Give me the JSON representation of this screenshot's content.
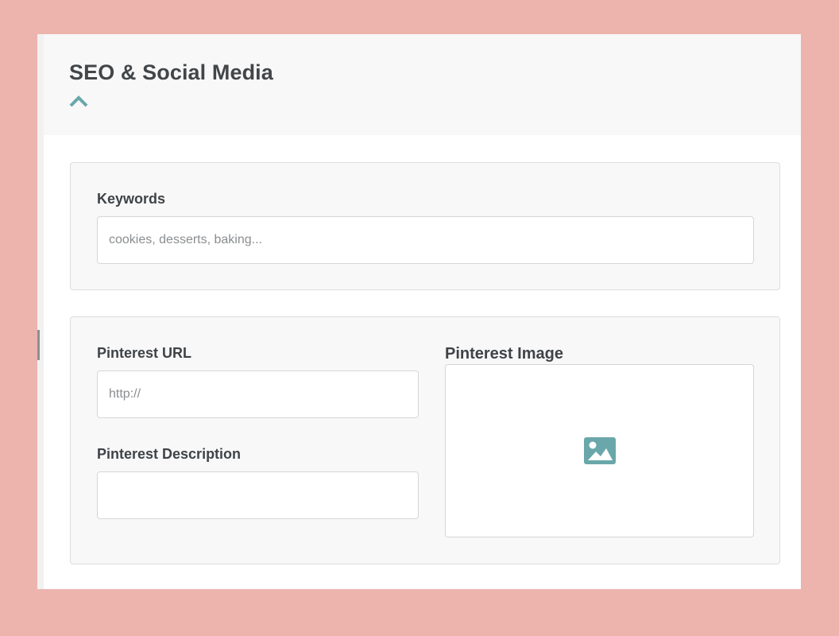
{
  "section": {
    "title": "SEO & Social Media",
    "toggle_icon": "chevron-up-icon",
    "toggle_state": "expanded"
  },
  "keywords": {
    "label": "Keywords",
    "value": "",
    "placeholder": "cookies, desserts, baking..."
  },
  "pinterest": {
    "url": {
      "label": "Pinterest URL",
      "value": "",
      "placeholder": "http://"
    },
    "description": {
      "label": "Pinterest Description",
      "value": "",
      "placeholder": ""
    },
    "image": {
      "label": "Pinterest Image",
      "icon": "image-icon"
    }
  },
  "colors": {
    "page_background": "#edb4ae",
    "card_background": "#ffffff",
    "panel_background": "#f8f8f8",
    "accent": "#6aa7aa",
    "text": "#3f4347",
    "placeholder": "#8a8d90",
    "border": "#d6d6d6"
  }
}
